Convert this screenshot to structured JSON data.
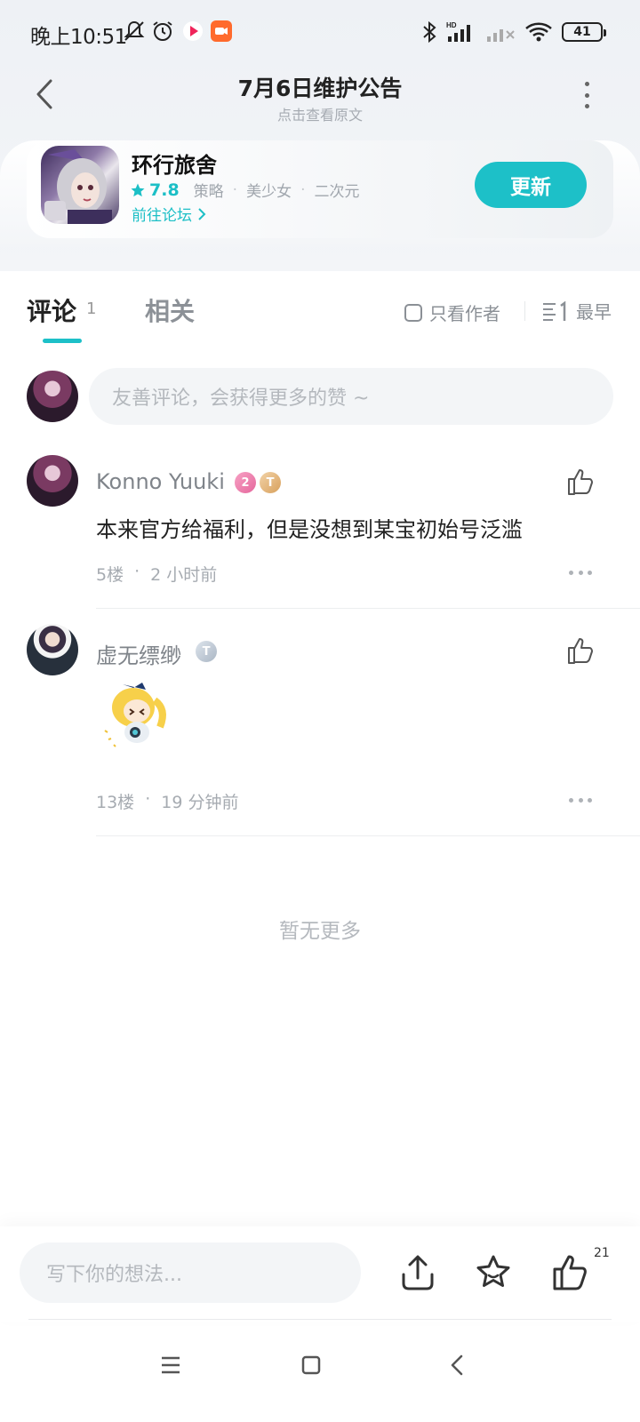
{
  "status_bar": {
    "time": "晚上10:51",
    "battery": "41",
    "icons": [
      "bell-off-icon",
      "alarm-icon",
      "video-app-icon",
      "camera-app-icon",
      "bluetooth-icon",
      "signal-icon",
      "signal-off-icon",
      "wifi-icon",
      "battery-icon"
    ]
  },
  "nav": {
    "title": "7月6日维护公告",
    "subtitle": "点击查看原文"
  },
  "game": {
    "name": "环行旅舍",
    "rating": "7.8",
    "tags": [
      "策略",
      "美少女",
      "二次元"
    ],
    "separator": "·",
    "forum_link": "前往论坛",
    "update_label": "更新",
    "accent": "#1dc0c8"
  },
  "tabs": {
    "comments_label": "评论",
    "comments_count": "1",
    "related_label": "相关",
    "author_only_label": "只看作者",
    "sort_label": "最早"
  },
  "comment_input": {
    "placeholder": "友善评论，会获得更多的赞 ~"
  },
  "comments": [
    {
      "username": "Konno Yuuki",
      "level_badge": "2",
      "rank_badge": "T",
      "text": "本来官方给福利，但是没想到某宝初始号泛滥",
      "floor": "5楼",
      "dot": "·",
      "time": "2 小时前"
    },
    {
      "username": "虚无缥缈",
      "rank_badge": "T",
      "floor": "13楼",
      "dot": "·",
      "time": "19 分钟前"
    }
  ],
  "footer_text": "暂无更多",
  "bottom_bar": {
    "placeholder": "写下你的想法...",
    "like_count": "21"
  }
}
